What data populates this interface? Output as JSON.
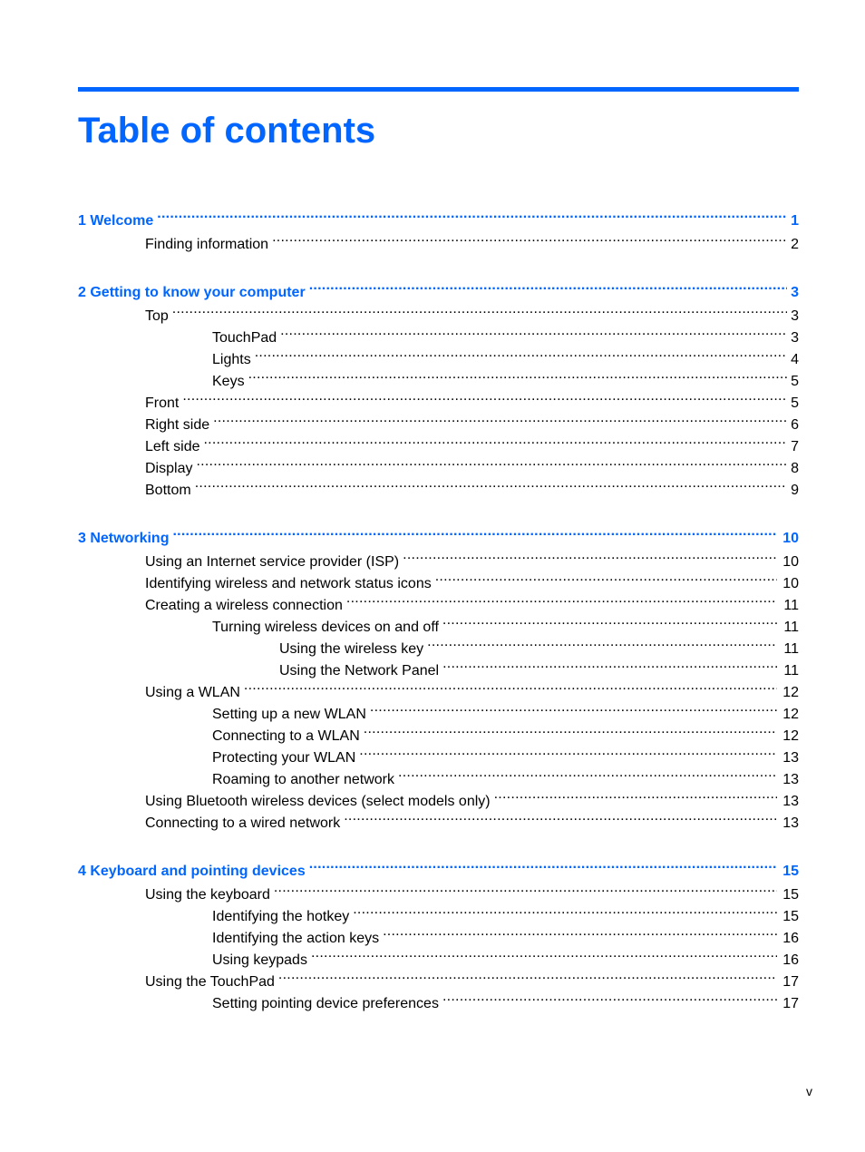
{
  "title": "Table of contents",
  "accent_color": "#0066ff",
  "entries": [
    {
      "level": 0,
      "label": "1  Welcome",
      "page": "1"
    },
    {
      "level": 1,
      "label": "Finding information",
      "page": "2"
    },
    {
      "level": 0,
      "label": "2  Getting to know your computer",
      "page": "3"
    },
    {
      "level": 1,
      "label": "Top",
      "page": "3"
    },
    {
      "level": 2,
      "label": "TouchPad",
      "page": "3"
    },
    {
      "level": 2,
      "label": "Lights",
      "page": "4"
    },
    {
      "level": 2,
      "label": "Keys",
      "page": "5"
    },
    {
      "level": 1,
      "label": "Front",
      "page": "5"
    },
    {
      "level": 1,
      "label": "Right side",
      "page": "6"
    },
    {
      "level": 1,
      "label": "Left side",
      "page": "7"
    },
    {
      "level": 1,
      "label": "Display",
      "page": "8"
    },
    {
      "level": 1,
      "label": "Bottom",
      "page": "9"
    },
    {
      "level": 0,
      "label": "3  Networking",
      "page": "10"
    },
    {
      "level": 1,
      "label": "Using an Internet service provider (ISP)",
      "page": "10"
    },
    {
      "level": 1,
      "label": "Identifying wireless and network status icons",
      "page": "10"
    },
    {
      "level": 1,
      "label": "Creating a wireless connection",
      "page": "11"
    },
    {
      "level": 2,
      "label": "Turning wireless devices on and off",
      "page": "11"
    },
    {
      "level": 3,
      "label": "Using the wireless key",
      "page": "11"
    },
    {
      "level": 3,
      "label": "Using the Network Panel",
      "page": "11"
    },
    {
      "level": 1,
      "label": "Using a WLAN",
      "page": "12"
    },
    {
      "level": 2,
      "label": "Setting up a new WLAN",
      "page": "12"
    },
    {
      "level": 2,
      "label": "Connecting to a WLAN",
      "page": "12"
    },
    {
      "level": 2,
      "label": "Protecting your WLAN",
      "page": "13"
    },
    {
      "level": 2,
      "label": "Roaming to another network",
      "page": "13"
    },
    {
      "level": 1,
      "label": "Using Bluetooth wireless devices (select models only)",
      "page": "13"
    },
    {
      "level": 1,
      "label": "Connecting to a wired network",
      "page": "13"
    },
    {
      "level": 0,
      "label": "4  Keyboard and pointing devices",
      "page": "15"
    },
    {
      "level": 1,
      "label": "Using the keyboard",
      "page": "15"
    },
    {
      "level": 2,
      "label": "Identifying the hotkey",
      "page": "15"
    },
    {
      "level": 2,
      "label": "Identifying the action keys",
      "page": "16"
    },
    {
      "level": 2,
      "label": "Using keypads",
      "page": "16"
    },
    {
      "level": 1,
      "label": "Using the TouchPad",
      "page": "17"
    },
    {
      "level": 2,
      "label": "Setting pointing device preferences",
      "page": "17"
    }
  ],
  "folio": "v"
}
